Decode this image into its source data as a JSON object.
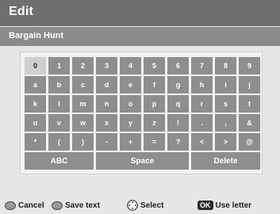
{
  "title": "Edit",
  "input": {
    "value": "Bargain Hunt"
  },
  "keyboard": {
    "rows": [
      [
        "0",
        "1",
        "2",
        "3",
        "4",
        "5",
        "6",
        "7",
        "8",
        "9"
      ],
      [
        "a",
        "b",
        "c",
        "d",
        "e",
        "f",
        "g",
        "h",
        "i",
        "j"
      ],
      [
        "k",
        "l",
        "m",
        "n",
        "o",
        "p",
        "q",
        "r",
        "s",
        "t"
      ],
      [
        "u",
        "v",
        "w",
        "x",
        "y",
        "z",
        "!",
        ".",
        ",",
        "&"
      ],
      [
        "*",
        "(",
        ")",
        "-",
        "+",
        "=",
        "?",
        "<",
        ">",
        "@"
      ]
    ],
    "selected": "0",
    "abc_label": "ABC",
    "space_label": "Space",
    "delete_label": "Delete"
  },
  "footer": {
    "cancel_label": "Cancel",
    "save_label": "Save text",
    "select_label": "Select",
    "ok_badge": "OK",
    "use_label": "Use letter"
  },
  "colors": {
    "title_bg": "#6f6f6f",
    "input_bg": "#8b8b8b",
    "key_bg": "#8e8e8e",
    "key_selected_bg": "#cfcfcf",
    "background": "#e6e6e6"
  }
}
